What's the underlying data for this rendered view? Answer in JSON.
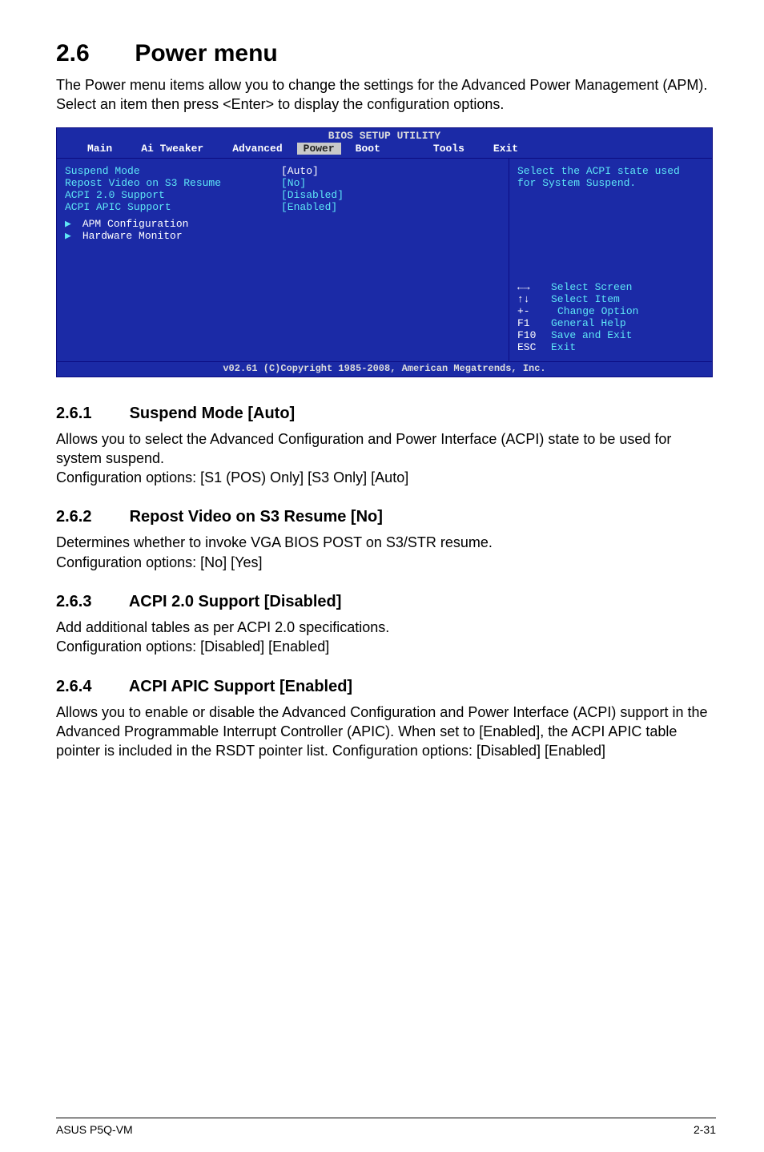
{
  "title": {
    "num": "2.6",
    "text": "Power menu"
  },
  "intro": "The Power menu items allow you to change the settings for the Advanced Power Management (APM). Select an item then press <Enter> to display the configuration options.",
  "bios": {
    "title": "BIOS SETUP UTILITY",
    "menu": [
      "Main",
      "Ai Tweaker",
      "Advanced",
      "Power",
      "Boot",
      "Tools",
      "Exit"
    ],
    "selected": "Power",
    "items": [
      {
        "label": "Suspend Mode",
        "value": "[Auto]"
      },
      {
        "label": "Repost Video on S3 Resume",
        "value": "[No]"
      },
      {
        "label": "ACPI 2.0 Support",
        "value": "[Disabled]"
      },
      {
        "label": "ACPI APIC Support",
        "value": "[Enabled]"
      }
    ],
    "submenus": [
      "APM Configuration",
      "Hardware Monitor"
    ],
    "help_desc": "Select the ACPI state used for System Suspend.",
    "help_keys": [
      {
        "k": "←→",
        "d": "Select Screen",
        "cls": "arrows"
      },
      {
        "k": "↑↓",
        "d": "Select Item",
        "cls": "updown"
      },
      {
        "k": "+-",
        "d": "Change Option"
      },
      {
        "k": "F1",
        "d": "General Help"
      },
      {
        "k": "F10",
        "d": "Save and Exit"
      },
      {
        "k": "ESC",
        "d": "Exit"
      }
    ],
    "footer": "v02.61 (C)Copyright 1985-2008, American Megatrends, Inc."
  },
  "sections": [
    {
      "num": "2.6.1",
      "title": "Suspend Mode [Auto]",
      "body": "Allows you to select the Advanced Configuration and Power Interface (ACPI) state to be used for system suspend.\nConfiguration options: [S1 (POS) Only] [S3 Only] [Auto]"
    },
    {
      "num": "2.6.2",
      "title": "Repost Video on S3 Resume [No]",
      "body": "Determines whether to invoke VGA BIOS POST on S3/STR resume.\nConfiguration options: [No] [Yes]"
    },
    {
      "num": "2.6.3",
      "title": "ACPI 2.0 Support [Disabled]",
      "body": "Add additional tables as per ACPI 2.0 specifications.\nConfiguration options: [Disabled] [Enabled]"
    },
    {
      "num": "2.6.4",
      "title": "ACPI APIC Support [Enabled]",
      "body": "Allows you to enable or disable the Advanced Configuration and Power Interface (ACPI) support in the Advanced Programmable Interrupt Controller (APIC). When set to [Enabled], the ACPI APIC table pointer is included in the RSDT pointer list. Configuration options: [Disabled] [Enabled]"
    }
  ],
  "footer": {
    "left": "ASUS P5Q-VM",
    "right": "2-31"
  }
}
